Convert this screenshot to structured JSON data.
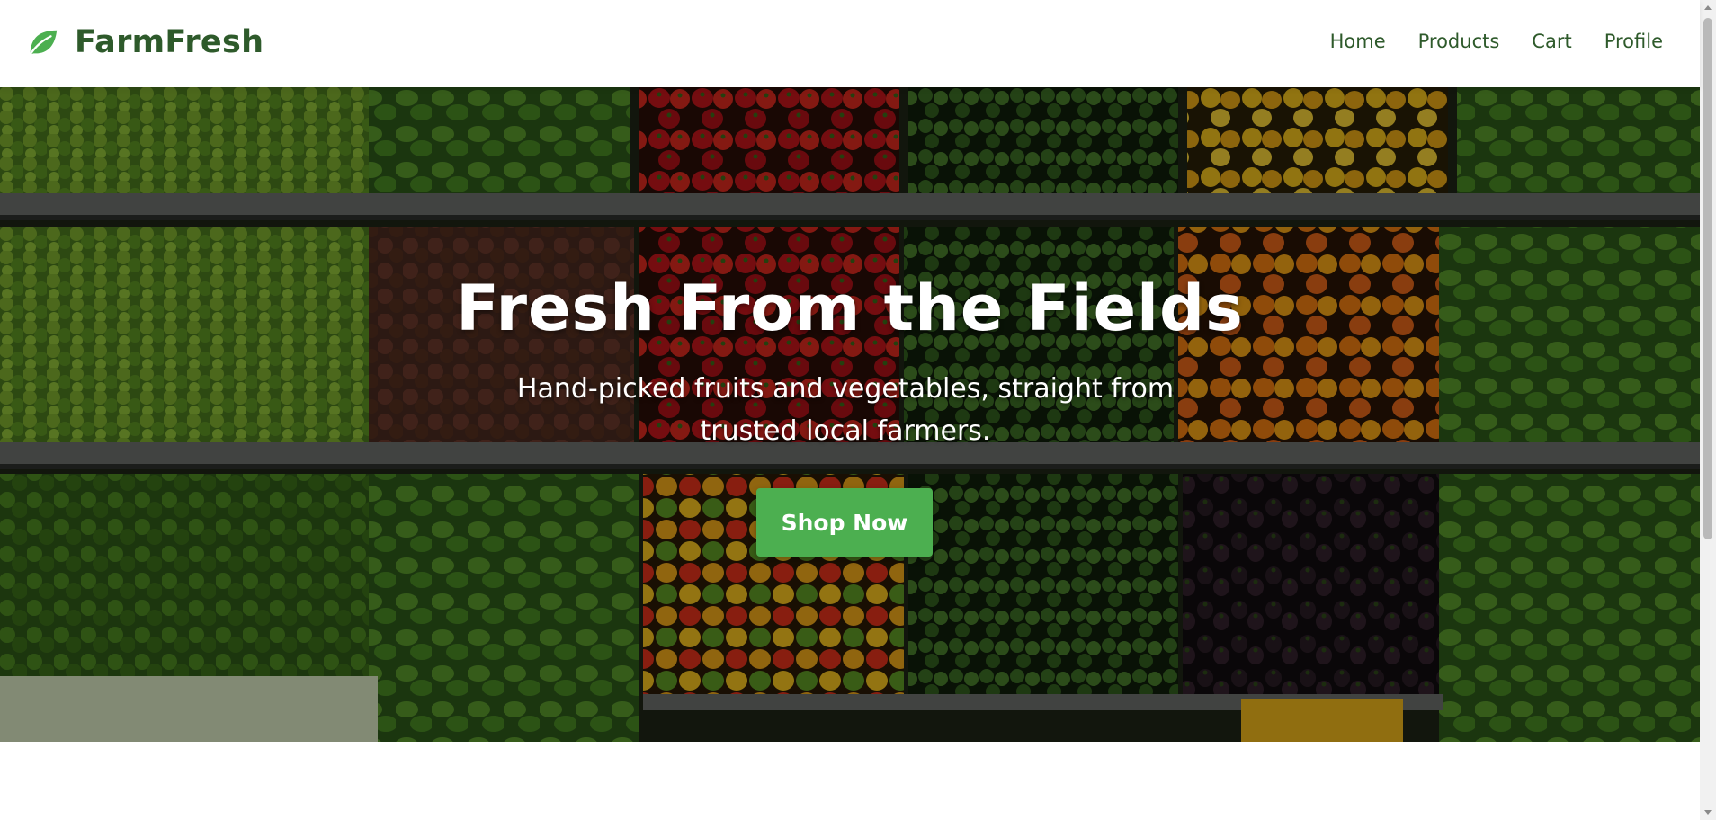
{
  "brand": {
    "name": "FarmFresh",
    "icon": "leaf-icon",
    "color": "#2e5a2b"
  },
  "nav": {
    "items": [
      {
        "label": "Home"
      },
      {
        "label": "Products"
      },
      {
        "label": "Cart"
      },
      {
        "label": "Profile"
      }
    ]
  },
  "hero": {
    "title": "Fresh From the Fields",
    "subtitle": "Hand-picked fruits and vegetables, straight from trusted local farmers.",
    "cta_label": "Shop Now",
    "cta_color": "#4caf50",
    "background_image": "produce-market-shelves"
  },
  "scrollbar": {
    "up_icon": "arrow-up-icon",
    "down_icon": "arrow-down-icon"
  }
}
